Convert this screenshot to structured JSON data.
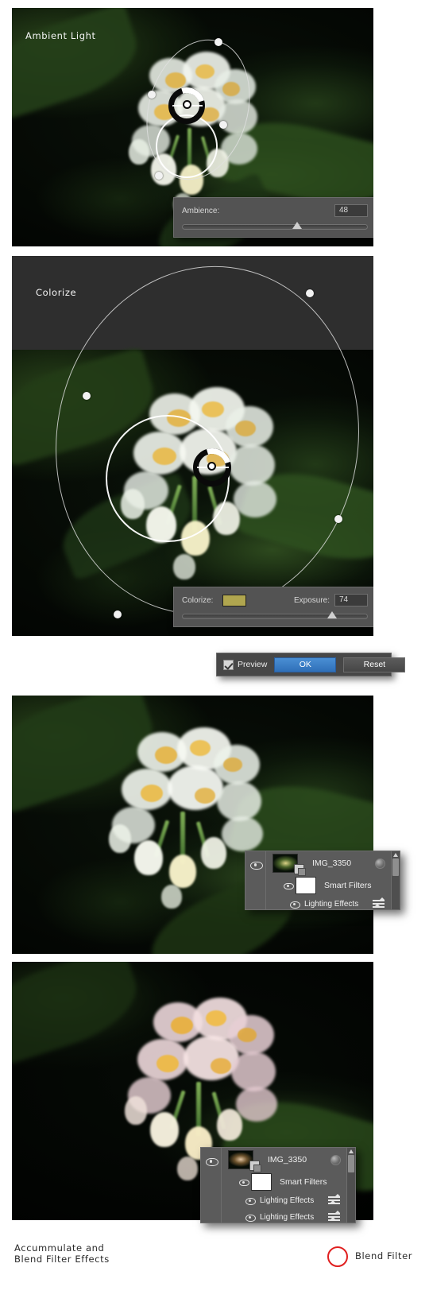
{
  "panels": [
    {
      "id": "ambient-light",
      "annotation": "Ambient Light",
      "control": {
        "label": "Ambience:",
        "value": "48",
        "slider_percent": 62
      }
    },
    {
      "id": "colorize",
      "annotation": "Colorize",
      "control": {
        "label": "Colorize:",
        "swatch_color": "#b0a64f",
        "second_label": "Exposure:",
        "value": "74",
        "slider_percent": 81
      },
      "buttons": {
        "preview_label": "Preview",
        "preview_checked": true,
        "ok_label": "OK",
        "reset_label": "Reset"
      }
    },
    {
      "id": "result-single-filter",
      "layers": {
        "layer_name": "IMG_3350",
        "smart_filters_label": "Smart Filters",
        "filters": [
          "Lighting Effects"
        ]
      }
    },
    {
      "id": "result-accumulated",
      "annotation": "Accummulate and\nBlend Filter Effects",
      "blend_annotation": "Blend Filter",
      "layers": {
        "layer_name": "IMG_3350",
        "smart_filters_label": "Smart Filters",
        "filters": [
          "Lighting Effects",
          "Lighting Effects"
        ]
      }
    }
  ],
  "icons": {
    "eye": "eye-icon",
    "fx_ball": "fx-options-icon",
    "blend": "blend-filter-icon",
    "scroll_up": "scroll-up-arrow-icon"
  },
  "colors": {
    "ok_button": "#2f6fb8",
    "swatch": "#b0a64f",
    "highlight_ring": "#e01f1f"
  }
}
